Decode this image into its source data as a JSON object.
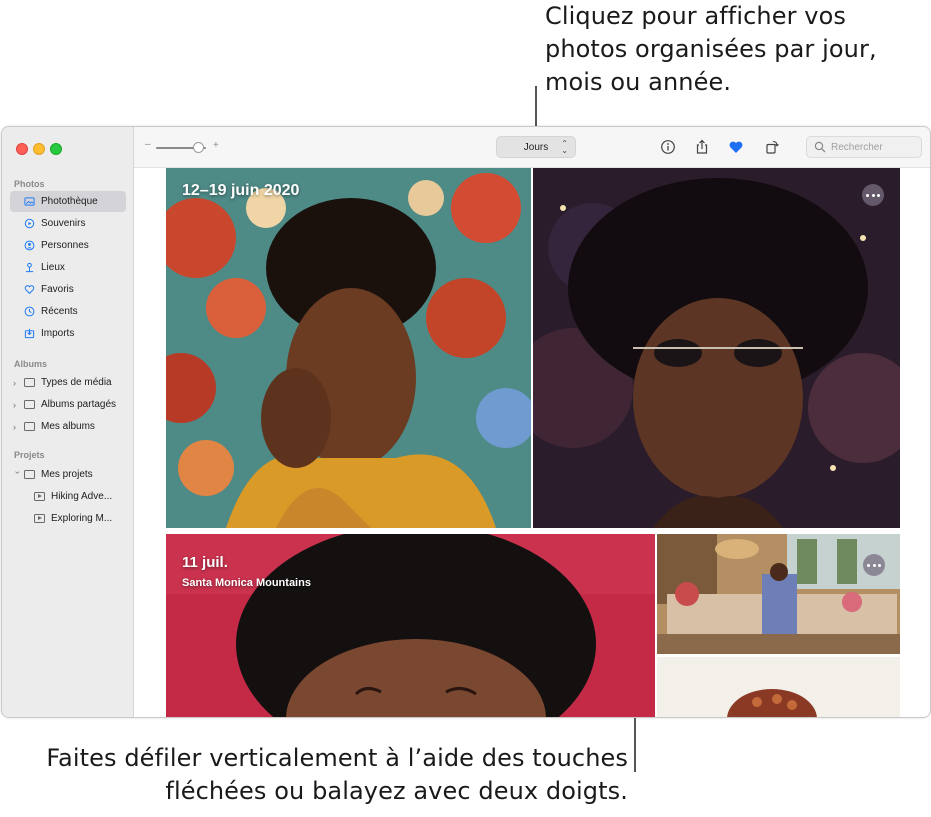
{
  "callouts": {
    "top": "Cliquez pour afficher vos photos organisées par jour, mois ou année.",
    "bottom_line1": "Faites défiler verticalement à l’aide des touches",
    "bottom_line2": "fléchées ou balayez avec deux doigts."
  },
  "sidebar": {
    "sections": {
      "photos": "Photos",
      "albums": "Albums",
      "projects": "Projets"
    },
    "photos_items": [
      {
        "label": "Photothèque",
        "icon": "library-icon",
        "active": true
      },
      {
        "label": "Souvenirs",
        "icon": "memories-icon"
      },
      {
        "label": "Personnes",
        "icon": "people-icon"
      },
      {
        "label": "Lieux",
        "icon": "places-icon"
      },
      {
        "label": "Favoris",
        "icon": "heart-icon"
      },
      {
        "label": "Récents",
        "icon": "clock-icon"
      },
      {
        "label": "Imports",
        "icon": "import-icon"
      }
    ],
    "album_items": [
      {
        "label": "Types de média"
      },
      {
        "label": "Albums partagés"
      },
      {
        "label": "Mes albums"
      }
    ],
    "project_items": [
      {
        "label": "Mes projets"
      },
      {
        "label": "Hiking Adve..."
      },
      {
        "label": "Exploring M..."
      }
    ]
  },
  "toolbar": {
    "zoom_minus": "–",
    "zoom_plus": "+",
    "zoom_level": 0.85,
    "view_select": "Jours",
    "search_placeholder": "Rechercher"
  },
  "content": {
    "group1_date": "12–19 juin 2020",
    "group2_date": "11 juil.",
    "group2_location": "Santa Monica Mountains"
  },
  "colors": {
    "accent": "#1f7bf6",
    "favorite": "#1f6ff2"
  }
}
